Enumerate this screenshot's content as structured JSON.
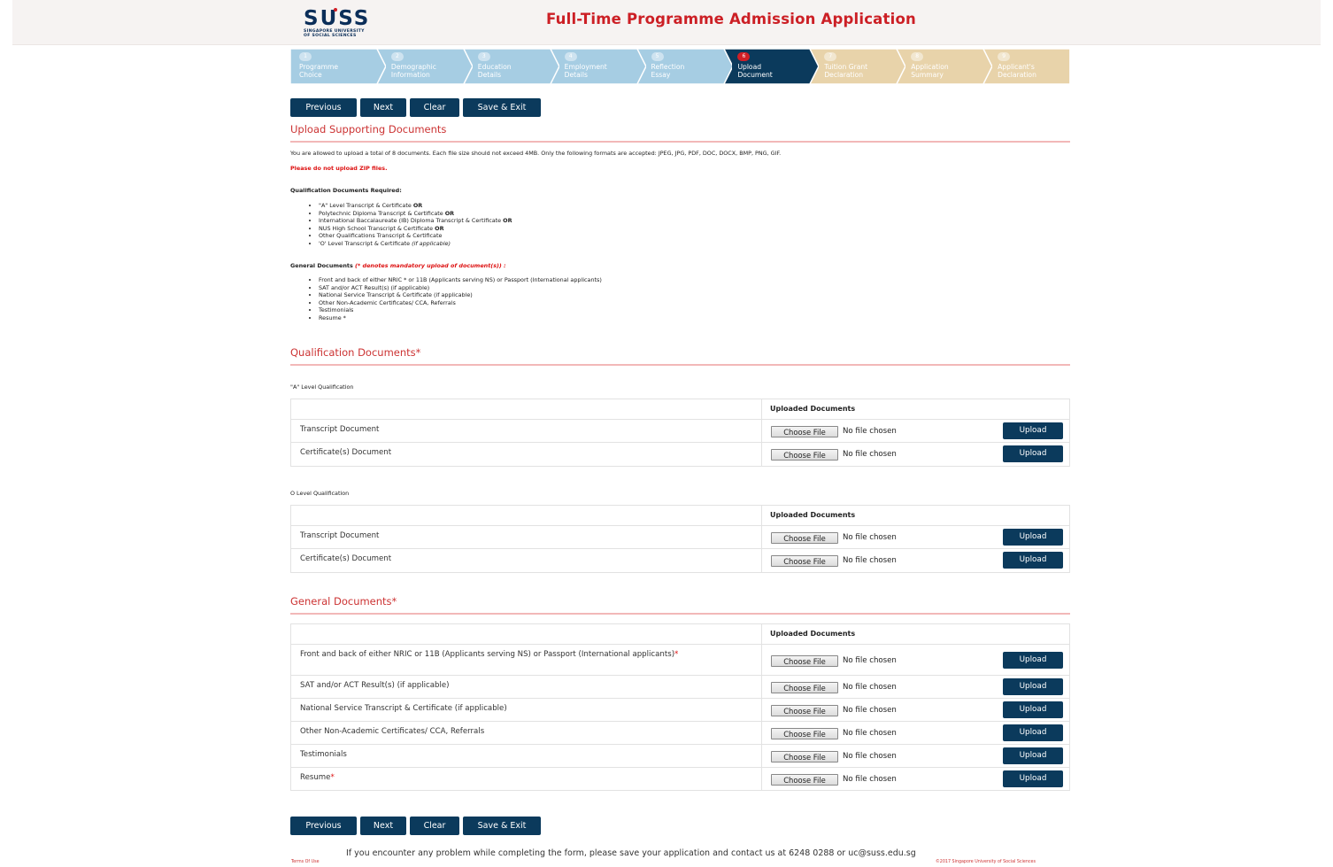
{
  "header": {
    "logo_text": "SUSS",
    "logo_sub_line1": "SINGAPORE UNIVERSITY",
    "logo_sub_line2": "OF SOCIAL SCIENCES",
    "title": "Full-Time Programme Admission Application"
  },
  "steps": [
    {
      "num": "1",
      "line1": "Programme",
      "line2": "Choice"
    },
    {
      "num": "2",
      "line1": "Demographic",
      "line2": "Information"
    },
    {
      "num": "3",
      "line1": "Education",
      "line2": "Details"
    },
    {
      "num": "4",
      "line1": "Employment",
      "line2": "Details"
    },
    {
      "num": "5",
      "line1": "Reflection",
      "line2": "Essay"
    },
    {
      "num": "6",
      "line1": "Upload",
      "line2": "Document"
    },
    {
      "num": "7",
      "line1": "Tuition Grant",
      "line2": "Declaration"
    },
    {
      "num": "8",
      "line1": "Application",
      "line2": "Summary"
    },
    {
      "num": "9",
      "line1": "Applicant's",
      "line2": "Declaration"
    }
  ],
  "colors": {
    "step_done": "#a6cde3",
    "step_active": "#0b3a5c",
    "step_todo": "#e8d3aa",
    "button": "#0b3a5c",
    "accent_red": "#cc1f25"
  },
  "nav": {
    "previous": "Previous",
    "next": "Next",
    "clear": "Clear",
    "save_exit": "Save & Exit"
  },
  "upload_section": {
    "title": "Upload Supporting Documents",
    "info": "You are allowed to upload a total of 8 documents. Each file size should not exceed 4MB. Only the following formats are accepted: JPEG, JPG, PDF, DOC, DOCX, BMP, PNG, GIF.",
    "zip_warning": "Please do not upload ZIP files.",
    "qual_required_heading": "Qualification Documents Required:",
    "qual_list": [
      {
        "text": "\"A\" Level Transcript & Certificate ",
        "suffix": "OR"
      },
      {
        "text": "Polytechnic Diploma Transcript & Certificate ",
        "suffix": "OR"
      },
      {
        "text": "International Baccalaureate (IB) Diploma Transcript & Certificate ",
        "suffix": "OR"
      },
      {
        "text": "NUS High School Transcript & Certificate ",
        "suffix": "OR"
      },
      {
        "text": "Other Qualifications Transcript & Certificate",
        "suffix": ""
      },
      {
        "text": "'O' Level Transcript & Certificate ",
        "suffix": "(if applicable)"
      }
    ],
    "general_heading": "General Documents",
    "general_note": " (* denotes mandatory upload of document(s)) :",
    "general_list": [
      "Front and back of either NRIC * or 11B (Applicants serving NS) or Passport (International applicants)",
      "SAT and/or ACT Result(s) (if applicable)",
      "National Service Transcript & Certificate (if applicable)",
      "Other Non-Academic Certificates/ CCA, Referrals",
      "Testimonials",
      "Resume *"
    ]
  },
  "qualification_section": {
    "title": "Qualification Documents",
    "title_mark": "*",
    "a_level_label": "\"A\" Level Qualification",
    "o_level_label": "O Level Qualification",
    "uploaded_header": "Uploaded Documents",
    "a_level_rows": [
      {
        "name": "Transcript Document",
        "req": ""
      },
      {
        "name": "Certificate(s) Document",
        "req": ""
      }
    ],
    "o_level_rows": [
      {
        "name": "Transcript Document",
        "req": ""
      },
      {
        "name": "Certificate(s) Document",
        "req": ""
      }
    ]
  },
  "general_section": {
    "title": "General Documents",
    "title_mark": "*",
    "uploaded_header": "Uploaded Documents",
    "rows": [
      {
        "name": "Front and back of either NRIC or 11B (Applicants serving NS) or Passport (International applicants)",
        "req": "*"
      },
      {
        "name": "SAT and/or ACT Result(s) (if applicable)",
        "req": ""
      },
      {
        "name": "National Service Transcript & Certificate (if applicable)",
        "req": ""
      },
      {
        "name": "Other Non-Academic Certificates/ CCA, Referrals",
        "req": ""
      },
      {
        "name": "Testimonials",
        "req": ""
      },
      {
        "name": "Resume",
        "req": "*"
      }
    ]
  },
  "file_input": {
    "choose_label": "Choose File",
    "no_file": "No file chosen",
    "upload_label": "Upload"
  },
  "footer": {
    "message": "If you encounter any problem while completing the form, please save your application and contact us at 6248 0288 or uc@suss.edu.sg",
    "terms": "Terms Of Use",
    "copyright": "©2017 Singapore University of Social Sciences"
  }
}
